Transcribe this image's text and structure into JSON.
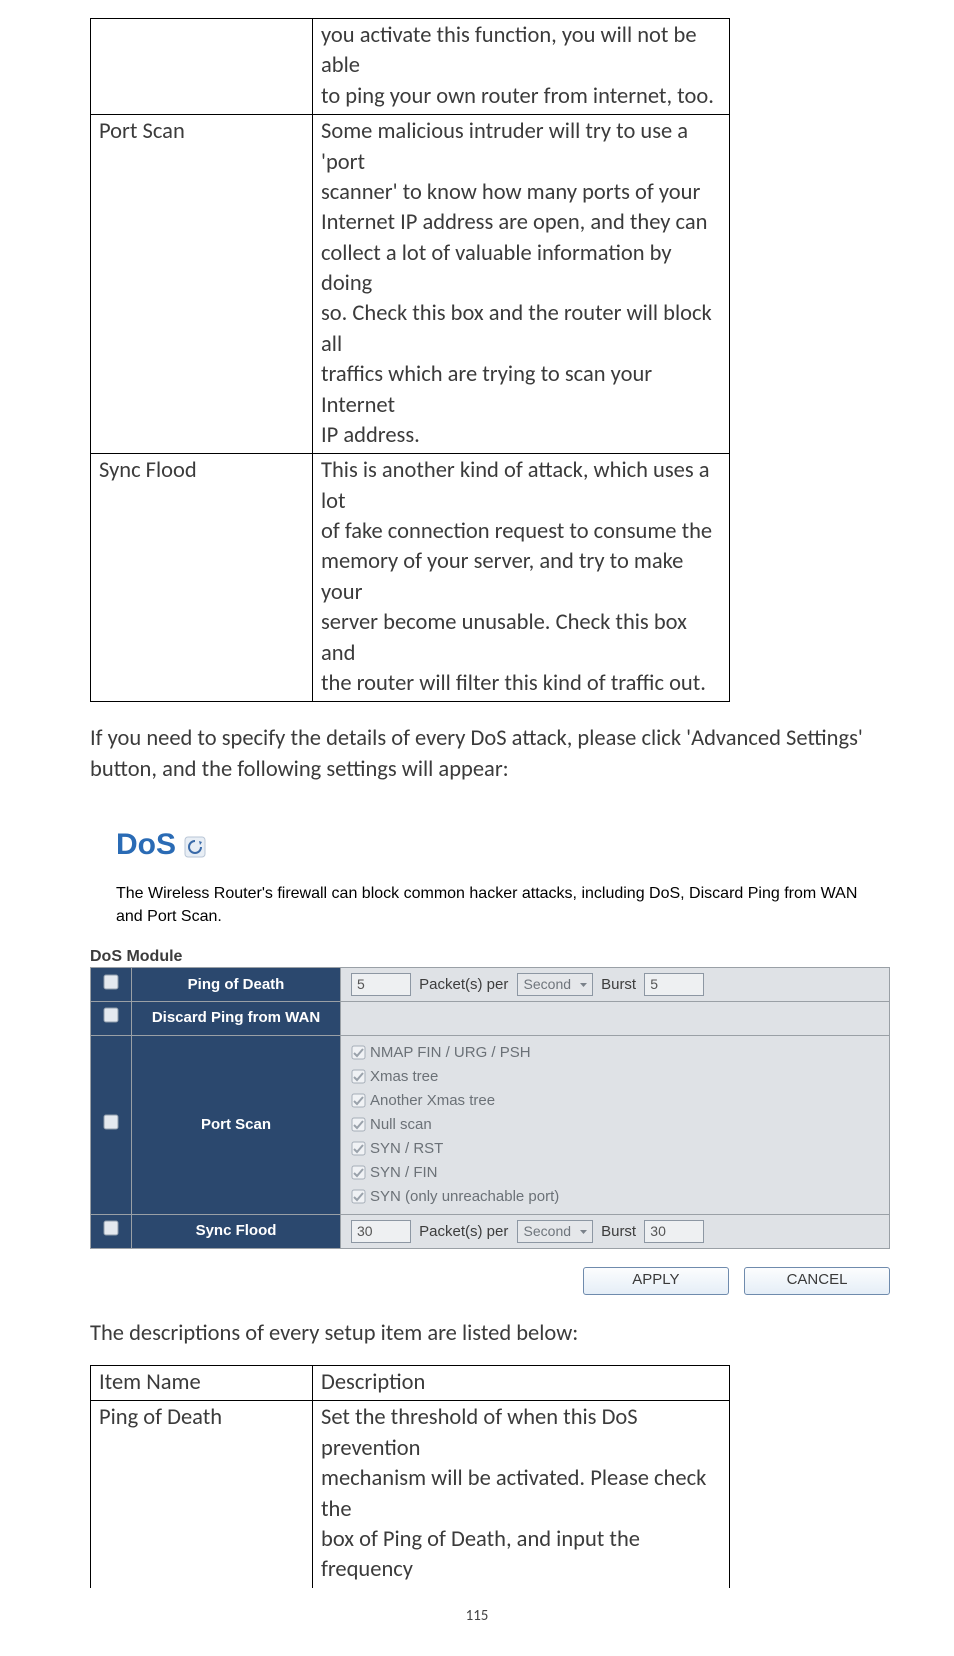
{
  "top_table": {
    "rows": [
      {
        "label": "",
        "desc_lines": [
          "you activate this function, you will not be able",
          "to ping your own router from internet, too."
        ]
      },
      {
        "label": "Port Scan",
        "desc_lines": [
          "Some malicious intruder will try to use a 'port",
          "scanner' to know how many ports of your",
          "Internet IP address are open, and they can",
          "collect a lot of valuable information by doing",
          "so. Check this box and the router will block all",
          "traffics which are trying to scan your Internet",
          "IP address."
        ]
      },
      {
        "label": "Sync Flood",
        "desc_lines": [
          "This is another kind of attack, which uses a lot",
          "of fake connection request to consume the",
          "memory of your server, and try to make your",
          "server become unusable. Check this box and",
          "the router will filter this kind of traffic out."
        ]
      }
    ]
  },
  "paragraph": "If you need to specify the details of every DoS attack, please click 'Advanced Settings' button, and the following settings will appear:",
  "dos_heading": "DoS",
  "intro_text": "The Wireless Router's firewall can block common hacker attacks, including DoS, Discard Ping from WAN and Port Scan.",
  "module_heading": "DoS Module",
  "module": {
    "ping_label": "Ping of Death",
    "ping_value": "5",
    "ping_packets_label": "Packet(s) per",
    "ping_unit": "Second",
    "ping_burst_label": "Burst",
    "ping_burst_value": "5",
    "discard_label": "Discard Ping from WAN",
    "portscan_label": "Port Scan",
    "portscan_items": [
      "NMAP FIN / URG / PSH",
      "Xmas tree",
      "Another Xmas tree",
      "Null scan",
      "SYN / RST",
      "SYN / FIN",
      "SYN (only unreachable port)"
    ],
    "sync_label": "Sync Flood",
    "sync_value": "30",
    "sync_packets_label": "Packet(s) per",
    "sync_unit": "Second",
    "sync_burst_label": "Burst",
    "sync_burst_value": "30"
  },
  "buttons": {
    "apply": "APPLY",
    "cancel": "CANCEL"
  },
  "desc_line": "The descriptions of every setup item are listed below:",
  "bottom_table": {
    "header": {
      "name": "Item Name",
      "desc": "Description"
    },
    "rows": [
      {
        "label": "Ping of Death",
        "desc_lines": [
          "Set the threshold of when this DoS prevention",
          "mechanism will be activated. Please check the",
          "box of Ping of Death, and input the frequency"
        ]
      }
    ]
  },
  "page_number": "115"
}
